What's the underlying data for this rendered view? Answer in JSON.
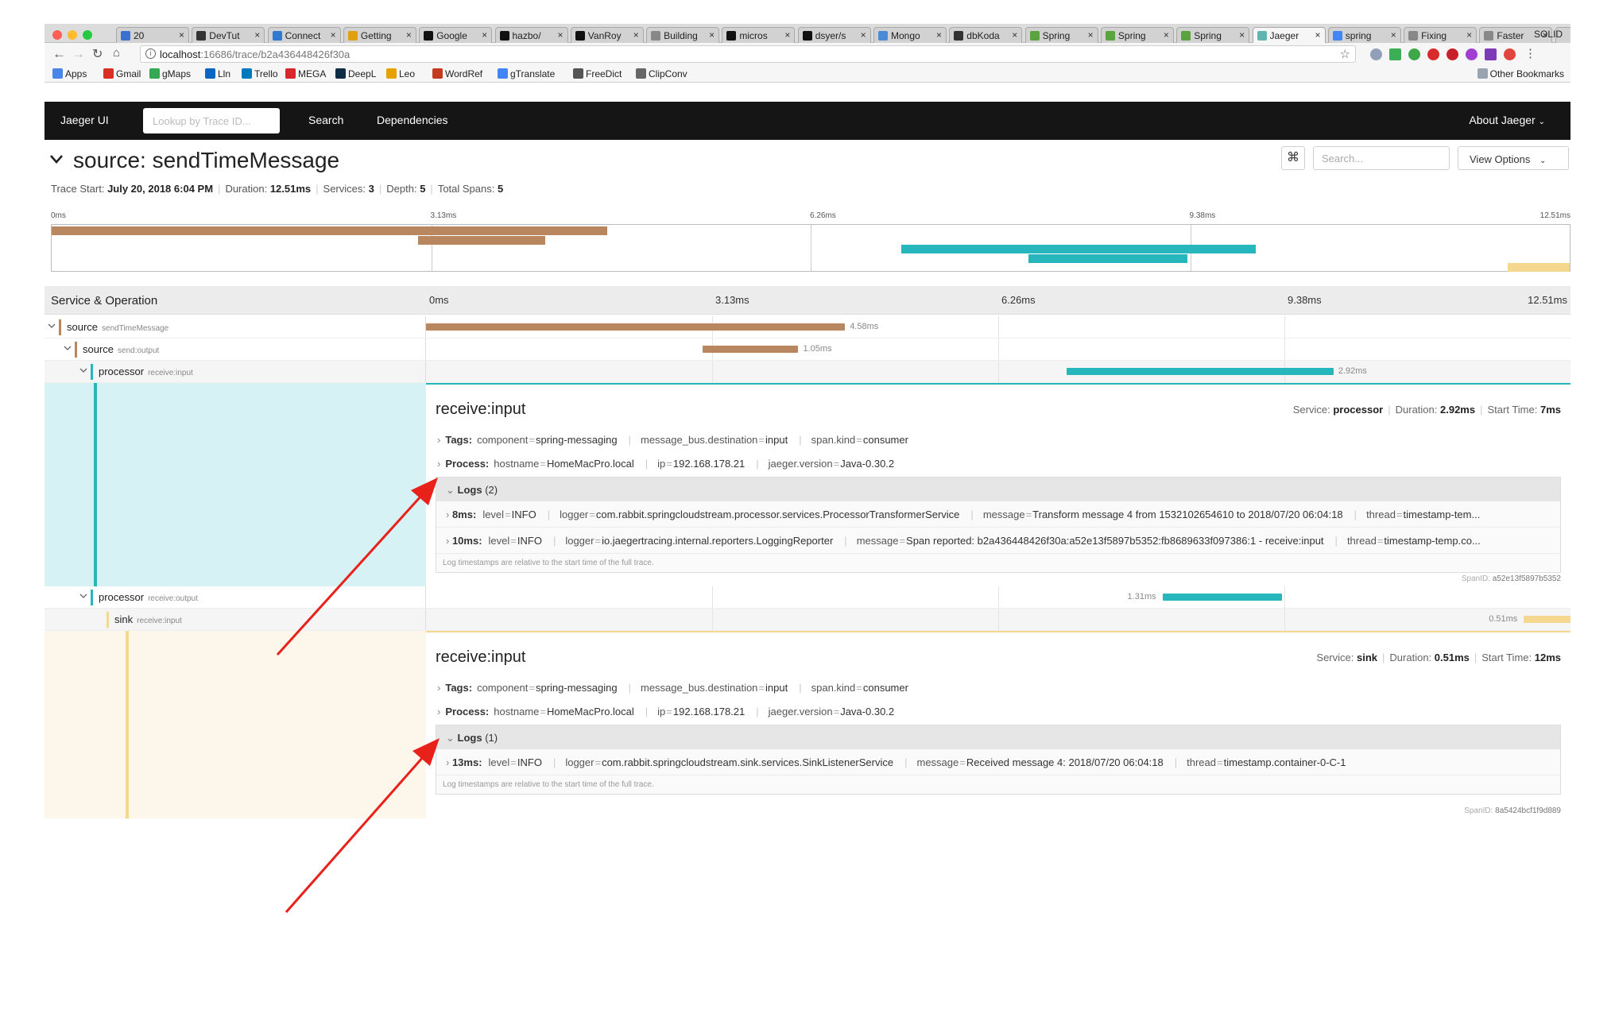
{
  "browser": {
    "tabs": [
      {
        "label": "20",
        "icon": "calendar-icon",
        "color": "#3b6fd0"
      },
      {
        "label": "DevTut",
        "icon": "terminal-icon",
        "color": "#333333"
      },
      {
        "label": "Connect",
        "icon": "globe-icon",
        "color": "#2e7ad1"
      },
      {
        "label": "Getting",
        "icon": "c-logo-icon",
        "color": "#e0a010"
      },
      {
        "label": "Google",
        "icon": "github-icon",
        "color": "#111111"
      },
      {
        "label": "hazbo/",
        "icon": "github-icon",
        "color": "#111111"
      },
      {
        "label": "VanRoy",
        "icon": "github-icon",
        "color": "#111111"
      },
      {
        "label": "Building",
        "icon": "page-icon",
        "color": "#888888"
      },
      {
        "label": "micros",
        "icon": "github-icon",
        "color": "#111111"
      },
      {
        "label": "dsyer/s",
        "icon": "github-icon",
        "color": "#111111"
      },
      {
        "label": "Mongo",
        "icon": "info-icon",
        "color": "#4a8bd4"
      },
      {
        "label": "dbKoda",
        "icon": "db-icon",
        "color": "#333333"
      },
      {
        "label": "Spring",
        "icon": "spring-icon",
        "color": "#5aa33f"
      },
      {
        "label": "Spring",
        "icon": "spring-icon",
        "color": "#5aa33f"
      },
      {
        "label": "Spring",
        "icon": "spring-icon",
        "color": "#5aa33f"
      },
      {
        "label": "Jaeger",
        "icon": "jaeger-icon",
        "color": "#60b5b0"
      },
      {
        "label": "spring",
        "icon": "google-icon",
        "color": "#4285f4"
      },
      {
        "label": "Fixing",
        "icon": "page-icon",
        "color": "#888888"
      },
      {
        "label": "Faster",
        "icon": "page-icon",
        "color": "#888888"
      }
    ],
    "active_tab": 15,
    "profile": "SOLID",
    "url_host": "localhost",
    "url_rest": ":16686/trace/b2a436448426f30a",
    "bookmarks": [
      {
        "label": "Apps",
        "color": "#4a86e8"
      },
      {
        "label": "Gmail",
        "color": "#d93025"
      },
      {
        "label": "gMaps",
        "color": "#34a853"
      },
      {
        "label": "Lln",
        "color": "#0a66c2"
      },
      {
        "label": "Trello",
        "color": "#0079bf"
      },
      {
        "label": "MEGA",
        "color": "#d9272e"
      },
      {
        "label": "DeepL",
        "color": "#0f2b46"
      },
      {
        "label": "Leo",
        "color": "#e8a200"
      },
      {
        "label": "WordRef",
        "color": "#c43b1f"
      },
      {
        "label": "gTranslate",
        "color": "#4285f4"
      },
      {
        "label": "FreeDict",
        "color": "#555555"
      },
      {
        "label": "ClipConv",
        "color": "#666666"
      }
    ],
    "other_bookmarks": "Other Bookmarks"
  },
  "nav": {
    "brand": "Jaeger UI",
    "lookup_placeholder": "Lookup by Trace ID...",
    "search": "Search",
    "dependencies": "Dependencies",
    "about": "About Jaeger"
  },
  "trace": {
    "title": "source: sendTimeMessage",
    "meta": {
      "start_label": "Trace Start:",
      "start": "July 20, 2018 6:04 PM",
      "duration_label": "Duration:",
      "duration": "12.51ms",
      "services_label": "Services:",
      "services": "3",
      "depth_label": "Depth:",
      "depth": "5",
      "spans_label": "Total Spans:",
      "spans": "5"
    },
    "search_placeholder": "Search...",
    "view_options": "View Options",
    "kbd": "⌘"
  },
  "timeline": {
    "header_label": "Service & Operation",
    "ticks": [
      "0ms",
      "3.13ms",
      "6.26ms",
      "9.38ms",
      "12.51ms"
    ]
  },
  "colors": {
    "source": "#b8865f",
    "processor": "#28b6bd",
    "sink": "#f5d790",
    "processor_bg": "#d6f2f4",
    "sink_bg": "#fdf6ea"
  },
  "spans": [
    {
      "service": "source",
      "operation": "sendTimeMessage",
      "duration": "4.58ms",
      "color": "#b8865f",
      "start": 0.0,
      "dur_ms": 4.58
    },
    {
      "service": "source",
      "operation": "send:output",
      "duration": "1.05ms",
      "color": "#b8865f",
      "start": 3.02,
      "dur_ms": 1.05
    },
    {
      "service": "processor",
      "operation": "receive:input",
      "duration": "2.92ms",
      "color": "#28b6bd",
      "start": 7.0,
      "dur_ms": 2.92
    },
    {
      "service": "processor",
      "operation": "receive:output",
      "duration": "1.31ms",
      "color": "#28b6bd",
      "start": 8.05,
      "dur_ms": 1.31
    },
    {
      "service": "sink",
      "operation": "receive:input",
      "duration": "0.51ms",
      "color": "#f5d790",
      "start": 12.0,
      "dur_ms": 0.51
    }
  ],
  "details": [
    {
      "title": "receive:input",
      "service_label": "Service:",
      "service": "processor",
      "duration_label": "Duration:",
      "duration": "2.92ms",
      "start_label": "Start Time:",
      "start": "7ms",
      "tags_label": "Tags:",
      "tags": [
        {
          "k": "component",
          "v": "spring-messaging"
        },
        {
          "k": "message_bus.destination",
          "v": "input"
        },
        {
          "k": "span.kind",
          "v": "consumer"
        }
      ],
      "process_label": "Process:",
      "process": [
        {
          "k": "hostname",
          "v": "HomeMacPro.local"
        },
        {
          "k": "ip",
          "v": "192.168.178.21"
        },
        {
          "k": "jaeger.version",
          "v": "Java-0.30.2"
        }
      ],
      "logs_label": "Logs",
      "logs_count": "(2)",
      "logs": [
        {
          "ts": "8ms:",
          "fields": [
            {
              "k": "level",
              "v": "INFO"
            },
            {
              "k": "logger",
              "v": "com.rabbit.springcloudstream.processor.services.ProcessorTransformerService"
            },
            {
              "k": "message",
              "v": "Transform message 4 from 1532102654610 to 2018/07/20 06:04:18"
            },
            {
              "k": "thread",
              "v": "timestamp-tem..."
            }
          ]
        },
        {
          "ts": "10ms:",
          "fields": [
            {
              "k": "level",
              "v": "INFO"
            },
            {
              "k": "logger",
              "v": "io.jaegertracing.internal.reporters.LoggingReporter"
            },
            {
              "k": "message",
              "v": "Span reported: b2a436448426f30a:a52e13f5897b5352:fb8689633f097386:1 - receive:input"
            },
            {
              "k": "thread",
              "v": "timestamp-temp.co..."
            }
          ]
        }
      ],
      "logs_note": "Log timestamps are relative to the start time of the full trace.",
      "span_id_label": "SpanID:",
      "span_id": "a52e13f5897b5352"
    },
    {
      "title": "receive:input",
      "service_label": "Service:",
      "service": "sink",
      "duration_label": "Duration:",
      "duration": "0.51ms",
      "start_label": "Start Time:",
      "start": "12ms",
      "tags_label": "Tags:",
      "tags": [
        {
          "k": "component",
          "v": "spring-messaging"
        },
        {
          "k": "message_bus.destination",
          "v": "input"
        },
        {
          "k": "span.kind",
          "v": "consumer"
        }
      ],
      "process_label": "Process:",
      "process": [
        {
          "k": "hostname",
          "v": "HomeMacPro.local"
        },
        {
          "k": "ip",
          "v": "192.168.178.21"
        },
        {
          "k": "jaeger.version",
          "v": "Java-0.30.2"
        }
      ],
      "logs_label": "Logs",
      "logs_count": "(1)",
      "logs": [
        {
          "ts": "13ms:",
          "fields": [
            {
              "k": "level",
              "v": "INFO"
            },
            {
              "k": "logger",
              "v": "com.rabbit.springcloudstream.sink.services.SinkListenerService"
            },
            {
              "k": "message",
              "v": "Received message 4: 2018/07/20 06:04:18"
            },
            {
              "k": "thread",
              "v": "timestamp.container-0-C-1"
            }
          ]
        }
      ],
      "logs_note": "Log timestamps are relative to the start time of the full trace.",
      "span_id_label": "SpanID:",
      "span_id": "8a5424bcf1f9d889"
    }
  ],
  "annotation_color": "#e8221a"
}
